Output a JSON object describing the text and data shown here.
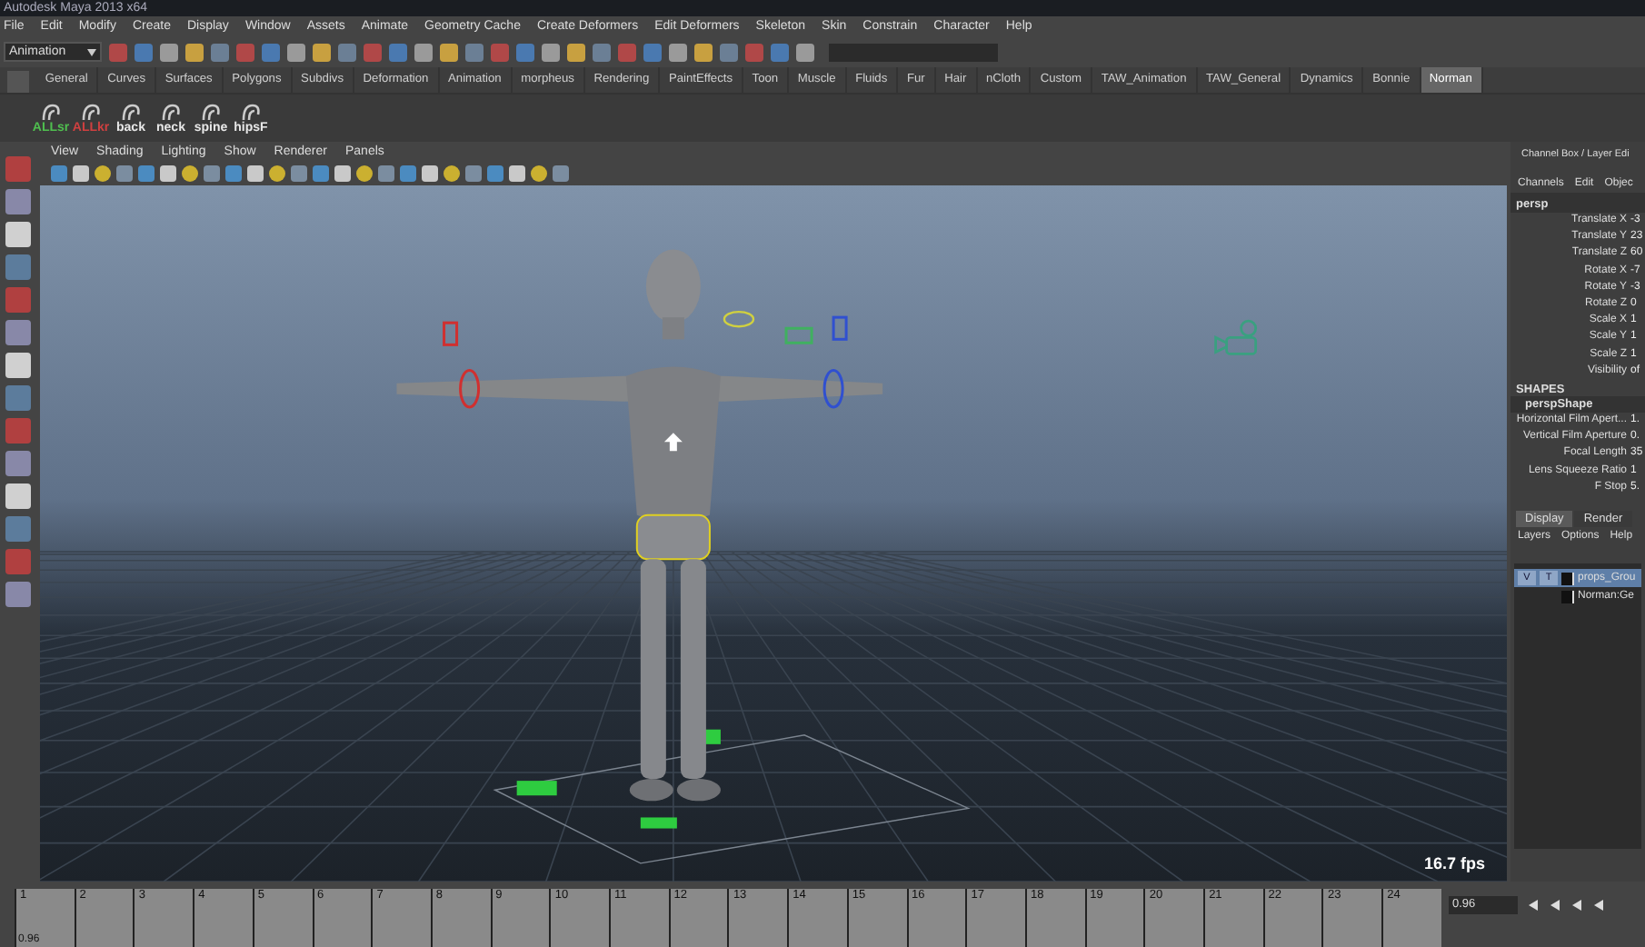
{
  "window": {
    "title": "Autodesk Maya 2013 x64"
  },
  "menu_bar": [
    "File",
    "Edit",
    "Modify",
    "Create",
    "Display",
    "Window",
    "Assets",
    "Animate",
    "Geometry Cache",
    "Create Deformers",
    "Edit Deformers",
    "Skeleton",
    "Skin",
    "Constrain",
    "Character",
    "Help"
  ],
  "status_line": {
    "mode": "Animation"
  },
  "shelf_tabs": [
    {
      "label": "General",
      "selected": false
    },
    {
      "label": "Curves",
      "selected": false
    },
    {
      "label": "Surfaces",
      "selected": false
    },
    {
      "label": "Polygons",
      "selected": false
    },
    {
      "label": "Subdivs",
      "selected": false
    },
    {
      "label": "Deformation",
      "selected": false
    },
    {
      "label": "Animation",
      "selected": false
    },
    {
      "label": "morpheus",
      "selected": false
    },
    {
      "label": "Rendering",
      "selected": false
    },
    {
      "label": "PaintEffects",
      "selected": false
    },
    {
      "label": "Toon",
      "selected": false
    },
    {
      "label": "Muscle",
      "selected": false
    },
    {
      "label": "Fluids",
      "selected": false
    },
    {
      "label": "Fur",
      "selected": false
    },
    {
      "label": "Hair",
      "selected": false
    },
    {
      "label": "nCloth",
      "selected": false
    },
    {
      "label": "Custom",
      "selected": false
    },
    {
      "label": "TAW_Animation",
      "selected": false
    },
    {
      "label": "TAW_General",
      "selected": false
    },
    {
      "label": "Dynamics",
      "selected": false
    },
    {
      "label": "Bonnie",
      "selected": false
    },
    {
      "label": "Norman",
      "selected": true
    }
  ],
  "shelf_buttons": [
    {
      "label": "ALLsr",
      "color": "#4fbf4f"
    },
    {
      "label": "ALLkr",
      "color": "#d04040"
    },
    {
      "label": "back",
      "color": "#e8e8e8"
    },
    {
      "label": "neck",
      "color": "#e8e8e8"
    },
    {
      "label": "spine",
      "color": "#e8e8e8"
    },
    {
      "label": "hipsF",
      "color": "#e8e8e8"
    }
  ],
  "viewport": {
    "menu": [
      "View",
      "Shading",
      "Lighting",
      "Show",
      "Renderer",
      "Panels"
    ],
    "fps": "16.7 fps"
  },
  "channel_box": {
    "title": "Channel Box / Layer Edi",
    "menu": [
      "Channels",
      "Edit",
      "Objec"
    ],
    "object": "persp",
    "channels": [
      {
        "name": "Translate X",
        "value": "-3"
      },
      {
        "name": "Translate Y",
        "value": "23"
      },
      {
        "name": "Translate Z",
        "value": "60"
      },
      {
        "name": "Rotate X",
        "value": "-7"
      },
      {
        "name": "Rotate Y",
        "value": "-3"
      },
      {
        "name": "Rotate Z",
        "value": "0"
      },
      {
        "name": "Scale X",
        "value": "1"
      },
      {
        "name": "Scale Y",
        "value": "1"
      },
      {
        "name": "Scale Z",
        "value": "1"
      },
      {
        "name": "Visibility",
        "value": "of"
      }
    ],
    "shapes_heading": "SHAPES",
    "shape": "perspShape",
    "shape_channels": [
      {
        "name": "Horizontal Film Apert...",
        "value": "1."
      },
      {
        "name": "Vertical Film Aperture",
        "value": "0."
      },
      {
        "name": "Focal Length",
        "value": "35"
      },
      {
        "name": "Lens Squeeze Ratio",
        "value": "1"
      },
      {
        "name": "F Stop",
        "value": "5."
      }
    ]
  },
  "layer_editor": {
    "tabs": [
      {
        "label": "Display",
        "selected": true
      },
      {
        "label": "Render",
        "selected": false
      }
    ],
    "menu": [
      "Layers",
      "Options",
      "Help"
    ],
    "layers": [
      {
        "v": "V",
        "t": "T",
        "name": "props_Grou",
        "selected": true
      },
      {
        "name": "Norman:Ge",
        "selected": false
      }
    ]
  },
  "time_slider": {
    "frames": [
      "1",
      "2",
      "3",
      "4",
      "5",
      "6",
      "7",
      "8",
      "9",
      "10",
      "11",
      "12",
      "13",
      "14",
      "15",
      "16",
      "17",
      "18",
      "19",
      "20",
      "21",
      "22",
      "23",
      "24"
    ],
    "start_value": "0.96",
    "current_value": "0.96"
  }
}
